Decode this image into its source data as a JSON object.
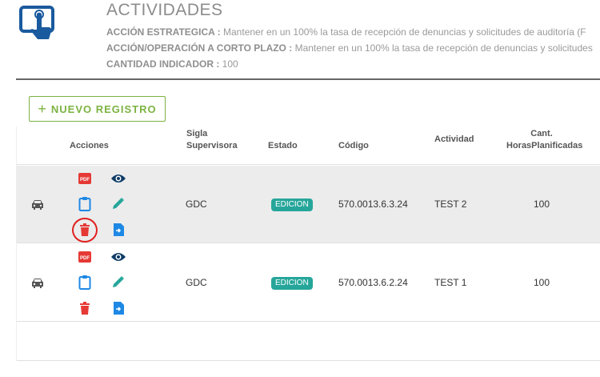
{
  "header": {
    "title": "ACTIVIDADES",
    "strategic_label": "ACCIÓN ESTRATEGICA :",
    "strategic_value": "Mantener en un 100% la tasa de recepción de denuncias y solicitudes de auditoría (F",
    "short_term_label": "ACCIÓN/OPERACIÓN A CORTO PLAZO :",
    "short_term_value": "Mantener en un 100% la tasa de recepción de denuncias y solicitudes",
    "indicator_label": "CANTIDAD INDICADOR :",
    "indicator_value": "100"
  },
  "toolbar": {
    "new_plus": "+",
    "new_label": "NUEVO REGISTRO"
  },
  "table": {
    "headers": {
      "acciones": "Acciones",
      "sigla_1": "Sigla",
      "sigla_2": "Supervisora",
      "estado": "Estado",
      "codigo": "Código",
      "actividad": "Actividad",
      "cant_1": "Cant.",
      "cant_2": "HorasPlanificadas"
    },
    "rows": [
      {
        "sigla": "GDC",
        "estado": "EDICION",
        "codigo": "570.0013.6.3.24",
        "actividad": "TEST 2",
        "horas": "100"
      },
      {
        "sigla": "GDC",
        "estado": "EDICION",
        "codigo": "570.0013.6.2.24",
        "actividad": "TEST 1",
        "horas": "100"
      }
    ]
  },
  "icons": {
    "pdf_text": "PDF",
    "pdf": "pdf-icon",
    "view": "eye-icon",
    "clipboard": "clipboard-icon",
    "edit": "pencil-icon",
    "delete": "trash-icon",
    "export": "file-export-icon",
    "vehicle": "car-icon"
  },
  "colors": {
    "accent_green": "#7cb342",
    "badge_teal": "#26a69a",
    "action_blue": "#1e88e5",
    "danger_red": "#e53935",
    "eye_navy": "#0d3b66",
    "edit_teal": "#26a69a"
  }
}
